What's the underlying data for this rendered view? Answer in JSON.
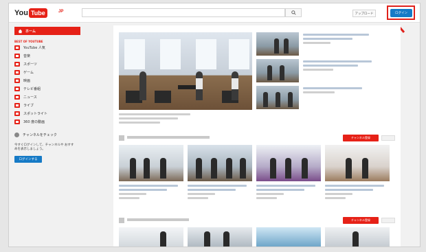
{
  "header": {
    "logo_you": "You",
    "logo_tube": "Tube",
    "region": "JP",
    "search_placeholder": "",
    "upload_label": "アップロード",
    "login_label": "ログイン"
  },
  "sidebar": {
    "home": "ホーム",
    "best_heading": "BEST OF YOUTUBE",
    "items": [
      {
        "label": "YouTube 人気",
        "icon": "popular-icon"
      },
      {
        "label": "音楽",
        "icon": "music-icon"
      },
      {
        "label": "スポーツ",
        "icon": "sports-icon"
      },
      {
        "label": "ゲーム",
        "icon": "gaming-icon"
      },
      {
        "label": "映画",
        "icon": "movies-icon"
      },
      {
        "label": "テレビ番組",
        "icon": "tv-icon"
      },
      {
        "label": "ニュース",
        "icon": "news-icon"
      },
      {
        "label": "ライブ",
        "icon": "live-icon"
      },
      {
        "label": "スポットライト",
        "icon": "spotlight-icon"
      },
      {
        "label": "360 度の動画",
        "icon": "360-icon"
      }
    ],
    "browse_channels": "チャンネルをチェック",
    "signin_note": "今すぐログインして、チャンネルや おすすめを表示しましょう。",
    "signin_button": "ログインする"
  },
  "sections": [
    {
      "subscribe_label": "チャンネル登録"
    },
    {
      "subscribe_label": "チャンネル登録"
    }
  ],
  "colors": {
    "brand_red": "#e62117",
    "login_blue": "#167ac6",
    "highlight_red": "#e0201a"
  }
}
